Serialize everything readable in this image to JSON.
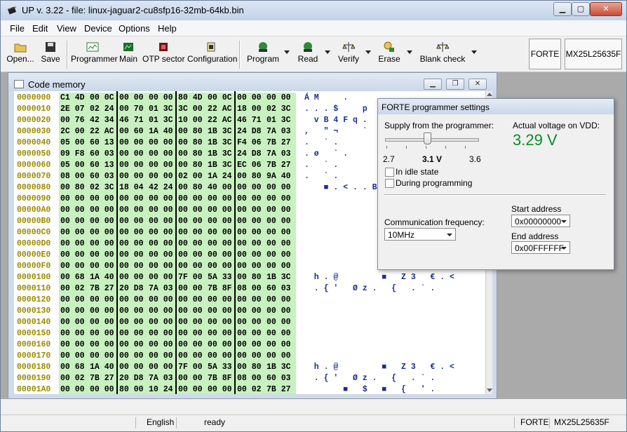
{
  "window": {
    "title": "UP v. 3.22 - file: linux-jaguar2-cu8sfp16-32mb-64kb.bin"
  },
  "menu": [
    "File",
    "Edit",
    "View",
    "Device",
    "Options",
    "Help"
  ],
  "toolbar": {
    "buttons": [
      {
        "label": "Open...",
        "icon": "open-folder-icon",
        "dropdown": false
      },
      {
        "label": "Save",
        "icon": "floppy-disk-icon",
        "dropdown": false
      },
      {
        "label": "Programmer",
        "icon": "programmer-icon",
        "dropdown": false
      },
      {
        "label": "Main",
        "icon": "main-memory-icon",
        "dropdown": false
      },
      {
        "label": "OTP sector",
        "icon": "otp-sector-icon",
        "dropdown": false
      },
      {
        "label": "Configuration",
        "icon": "configuration-icon",
        "dropdown": false
      },
      {
        "label": "Program",
        "icon": "program-icon",
        "dropdown": true
      },
      {
        "label": "Read",
        "icon": "read-icon",
        "dropdown": true
      },
      {
        "label": "Verify",
        "icon": "verify-icon",
        "dropdown": true
      },
      {
        "label": "Erase",
        "icon": "erase-icon",
        "dropdown": true
      },
      {
        "label": "Blank check",
        "icon": "blank-check-icon",
        "dropdown": true
      }
    ],
    "programmer_name": "FORTE",
    "chip_name": "MX25L25635F"
  },
  "code_memory": {
    "title": "Code memory",
    "rows": [
      {
        "addr": "0000000",
        "groups": [
          "C1 4D",
          "00 0C",
          "00 00",
          "00 00",
          "80 4D",
          "00 0C",
          "00 00",
          "00 00"
        ],
        "ascii": "Á M     .            "
      },
      {
        "addr": "0000010",
        "groups": [
          "2E 07",
          "02 24",
          "00 70",
          "01 3C",
          "3C 00",
          "22 AC",
          "18 00",
          "02 3C"
        ],
        "ascii": ". . . $     p       "
      },
      {
        "addr": "0000020",
        "groups": [
          "00 76",
          "42 34",
          "46 71",
          "01 3C",
          "10 00",
          "22 AC",
          "46 71",
          "01 3C"
        ],
        "ascii": "  v B 4 F q .       "
      },
      {
        "addr": "0000030",
        "groups": [
          "2C 00",
          "22 AC",
          "00 60",
          "1A 40",
          "00 80",
          "1B 3C",
          "24 D8",
          "7A 03"
        ],
        "ascii": ",   \" ¬     `       "
      },
      {
        "addr": "0000040",
        "groups": [
          "05 00",
          "60 13",
          "00 00",
          "00 00",
          "00 80",
          "1B 3C",
          "F4 06",
          "7B 27"
        ],
        "ascii": ".   ` .             "
      },
      {
        "addr": "0000050",
        "groups": [
          "09 F8",
          "60 03",
          "00 00",
          "00 00",
          "00 80",
          "1B 3C",
          "24 D8",
          "7A 03"
        ],
        "ascii": ". ø   ` .           "
      },
      {
        "addr": "0000060",
        "groups": [
          "05 00",
          "60 13",
          "00 00",
          "00 00",
          "00 80",
          "1B 3C",
          "EC 06",
          "7B 27"
        ],
        "ascii": ".   ` .             "
      },
      {
        "addr": "0000070",
        "groups": [
          "08 00",
          "60 03",
          "00 00",
          "00 00",
          "02 00",
          "1A 24",
          "00 80",
          "9A 40"
        ],
        "ascii": ".   ` .             "
      },
      {
        "addr": "0000080",
        "groups": [
          "00 80",
          "02 3C",
          "18 04",
          "42 24",
          "00 80",
          "40 00",
          "00 00",
          "00 00"
        ],
        "ascii": "    ■ . < . . B     "
      },
      {
        "addr": "0000090",
        "groups": [
          "00 00",
          "00 00",
          "00 00",
          "00 00",
          "00 00",
          "00 00",
          "00 00",
          "00 00"
        ],
        "ascii": ""
      },
      {
        "addr": "00000A0",
        "groups": [
          "00 00",
          "00 00",
          "00 00",
          "00 00",
          "00 00",
          "00 00",
          "00 00",
          "00 00"
        ],
        "ascii": ""
      },
      {
        "addr": "00000B0",
        "groups": [
          "00 00",
          "00 00",
          "00 00",
          "00 00",
          "00 00",
          "00 00",
          "00 00",
          "00 00"
        ],
        "ascii": ""
      },
      {
        "addr": "00000C0",
        "groups": [
          "00 00",
          "00 00",
          "00 00",
          "00 00",
          "00 00",
          "00 00",
          "00 00",
          "00 00"
        ],
        "ascii": ""
      },
      {
        "addr": "00000D0",
        "groups": [
          "00 00",
          "00 00",
          "00 00",
          "00 00",
          "00 00",
          "00 00",
          "00 00",
          "00 00"
        ],
        "ascii": ""
      },
      {
        "addr": "00000E0",
        "groups": [
          "00 00",
          "00 00",
          "00 00",
          "00 00",
          "00 00",
          "00 00",
          "00 00",
          "00 00"
        ],
        "ascii": ""
      },
      {
        "addr": "00000F0",
        "groups": [
          "00 00",
          "00 00",
          "00 00",
          "00 00",
          "00 00",
          "00 00",
          "00 00",
          "00 00"
        ],
        "ascii": ""
      },
      {
        "addr": "0000100",
        "groups": [
          "00 68",
          "1A 40",
          "00 00",
          "00 00",
          "7F 00",
          "5A 33",
          "00 80",
          "1B 3C"
        ],
        "ascii": "  h . @         ■   Z 3   € . <"
      },
      {
        "addr": "0000110",
        "groups": [
          "00 02",
          "7B 27",
          "20 D8",
          "7A 03",
          "00 00",
          "7B 8F",
          "08 00",
          "60 03"
        ],
        "ascii": "  . { '   Ø z .   {   . ` ."
      },
      {
        "addr": "0000120",
        "groups": [
          "00 00",
          "00 00",
          "00 00",
          "00 00",
          "00 00",
          "00 00",
          "00 00",
          "00 00"
        ],
        "ascii": ""
      },
      {
        "addr": "0000130",
        "groups": [
          "00 00",
          "00 00",
          "00 00",
          "00 00",
          "00 00",
          "00 00",
          "00 00",
          "00 00"
        ],
        "ascii": ""
      },
      {
        "addr": "0000140",
        "groups": [
          "00 00",
          "00 00",
          "00 00",
          "00 00",
          "00 00",
          "00 00",
          "00 00",
          "00 00"
        ],
        "ascii": ""
      },
      {
        "addr": "0000150",
        "groups": [
          "00 00",
          "00 00",
          "00 00",
          "00 00",
          "00 00",
          "00 00",
          "00 00",
          "00 00"
        ],
        "ascii": ""
      },
      {
        "addr": "0000160",
        "groups": [
          "00 00",
          "00 00",
          "00 00",
          "00 00",
          "00 00",
          "00 00",
          "00 00",
          "00 00"
        ],
        "ascii": ""
      },
      {
        "addr": "0000170",
        "groups": [
          "00 00",
          "00 00",
          "00 00",
          "00 00",
          "00 00",
          "00 00",
          "00 00",
          "00 00"
        ],
        "ascii": ""
      },
      {
        "addr": "0000180",
        "groups": [
          "00 68",
          "1A 40",
          "00 00",
          "00 00",
          "7F 00",
          "5A 33",
          "00 80",
          "1B 3C"
        ],
        "ascii": "  h . @         ■   Z 3   € . <"
      },
      {
        "addr": "0000190",
        "groups": [
          "00 02",
          "7B 27",
          "20 D8",
          "7A 03",
          "00 00",
          "7B 8F",
          "08 00",
          "60 03"
        ],
        "ascii": "  . { '   Ø z .   {   . ` ."
      },
      {
        "addr": "00001A0",
        "groups": [
          "00 00",
          "00 00",
          "80 00",
          "10 24",
          "00 00",
          "00 00",
          "00 02",
          "7B 27"
        ],
        "ascii": "        ■   $   ■   {   ' ."
      }
    ]
  },
  "settings": {
    "title": "FORTE programmer settings",
    "supply_label": "Supply from the programmer:",
    "voltage_label": "Actual voltage on VDD:",
    "voltage_value": "3.29 V",
    "slider_min": "2.7",
    "slider_value": "3.1 V",
    "slider_max": "3.6",
    "slider_fraction": 0.444,
    "idle_label": "In idle state",
    "idle_checked": false,
    "programming_label": "During programming",
    "programming_checked": false,
    "freq_label": "Communication frequency:",
    "freq_value": "10MHz",
    "start_label": "Start address",
    "start_value": "0x00000000",
    "end_label": "End address",
    "end_value": "0x00FFFFFF"
  },
  "status": {
    "language": "English",
    "state": "ready",
    "programmer": "FORTE",
    "chip": "MX25L25635F"
  },
  "colors": {
    "hex_bg": "#c8f0c0",
    "address": "#9c8a00",
    "ascii": "#1b2f8a",
    "voltage": "#0a8a2a"
  }
}
